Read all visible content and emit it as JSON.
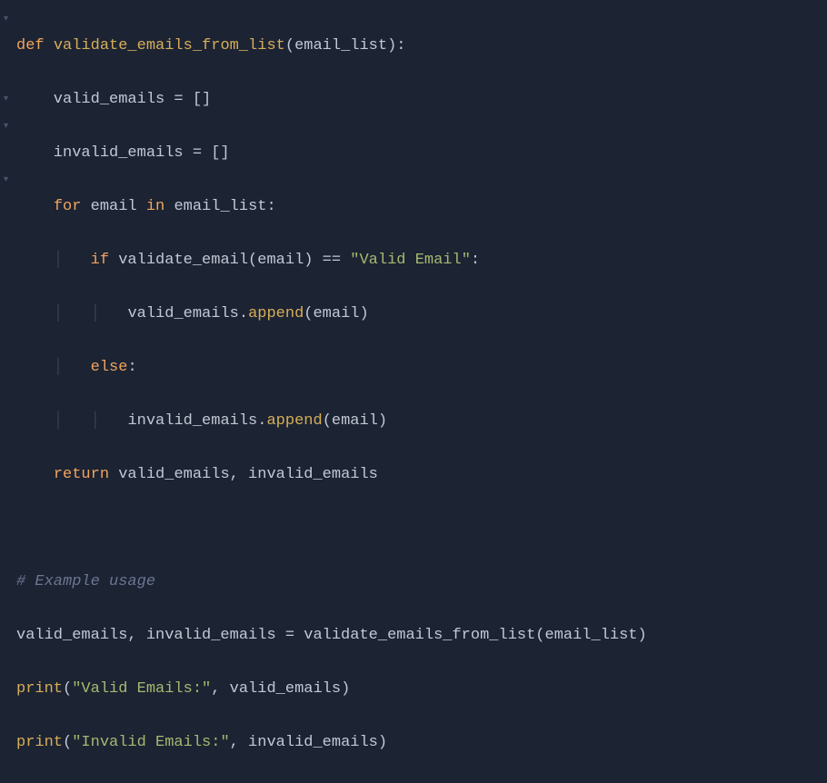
{
  "folds": [
    {
      "line": 0,
      "glyph": "▾"
    },
    {
      "line": 3,
      "glyph": "▾"
    },
    {
      "line": 4,
      "glyph": "▾"
    },
    {
      "line": 6,
      "glyph": "▾"
    }
  ],
  "code": {
    "l1_def": "def",
    "l1_fn": "validate_emails_from_list",
    "l1_open": "(",
    "l1_param": "email_list",
    "l1_close": "):",
    "l2": "    valid_emails = []",
    "l3": "    invalid_emails = []",
    "l4_for": "for",
    "l4_var": " email ",
    "l4_in": "in",
    "l4_iter": " email_list:",
    "l5_if": "if",
    "l5_call": " validate_email(email) == ",
    "l5_str": "\"Valid Email\"",
    "l5_colon": ":",
    "l6_target": "valid_emails.",
    "l6_method": "append",
    "l6_args": "(email)",
    "l7_else": "else",
    "l7_colon": ":",
    "l8_target": "invalid_emails.",
    "l8_method": "append",
    "l8_args": "(email)",
    "l9_return": "return",
    "l9_vals": " valid_emails, invalid_emails",
    "l11_comment": "# Example usage",
    "l12": "valid_emails, invalid_emails = validate_emails_from_list(email_list)",
    "l13_print": "print",
    "l13_open": "(",
    "l13_str": "\"Valid Emails:\"",
    "l13_rest": ", valid_emails)",
    "l14_print": "print",
    "l14_open": "(",
    "l14_str": "\"Invalid Emails:\"",
    "l14_rest": ", invalid_emails)"
  }
}
